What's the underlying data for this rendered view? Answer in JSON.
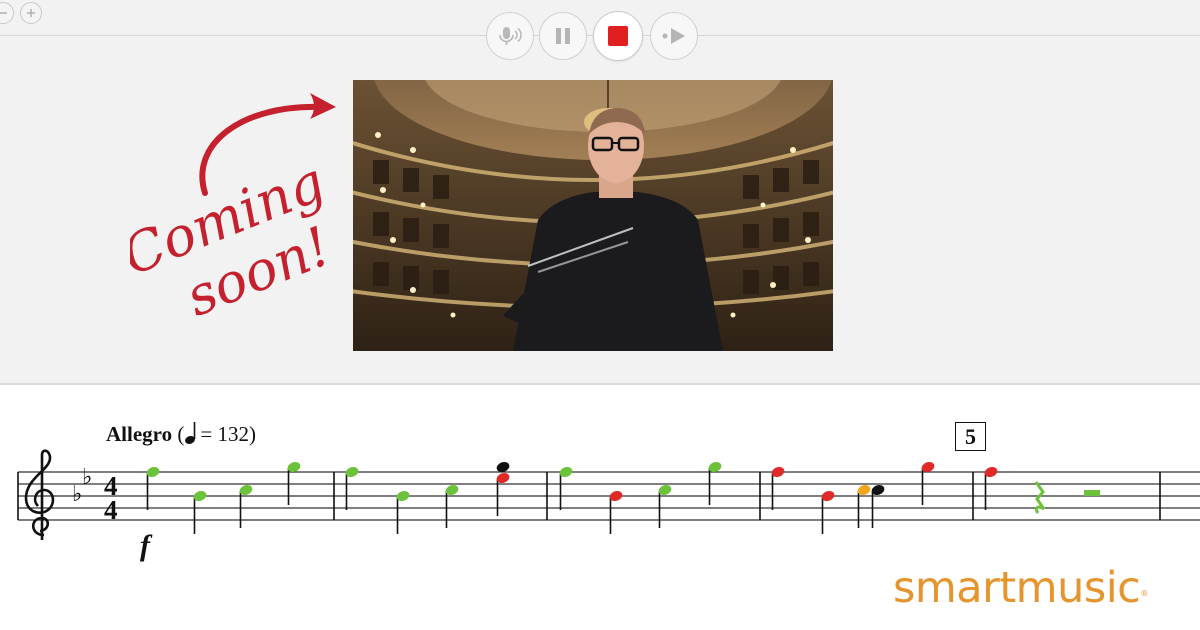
{
  "toolbar": {
    "buttons": [
      {
        "icon": "microphone-icon"
      },
      {
        "icon": "pause-icon"
      },
      {
        "icon": "stop-icon",
        "color": "#e02020"
      },
      {
        "icon": "play-from-here-icon"
      }
    ]
  },
  "window_controls": [
    {
      "icon": "minus-icon"
    },
    {
      "icon": "plus-icon"
    }
  ],
  "promo": {
    "annotation_line1": "Coming",
    "annotation_line2": "soon!",
    "annotation_color": "#c4202d"
  },
  "score": {
    "tempo_marking": "Allegro",
    "tempo_value": "= 132",
    "time_signature_top": "4",
    "time_signature_bottom": "4",
    "dynamic": "f",
    "rehearsal_mark": "5",
    "note_colors": {
      "correct": "#6cc23a",
      "incorrect": "#e02a2a",
      "rhythm": "#f2a71b",
      "unplayed": "#111111"
    }
  },
  "brand": {
    "name": "smartmusic",
    "trademark": "®",
    "color": "#e6952e"
  }
}
